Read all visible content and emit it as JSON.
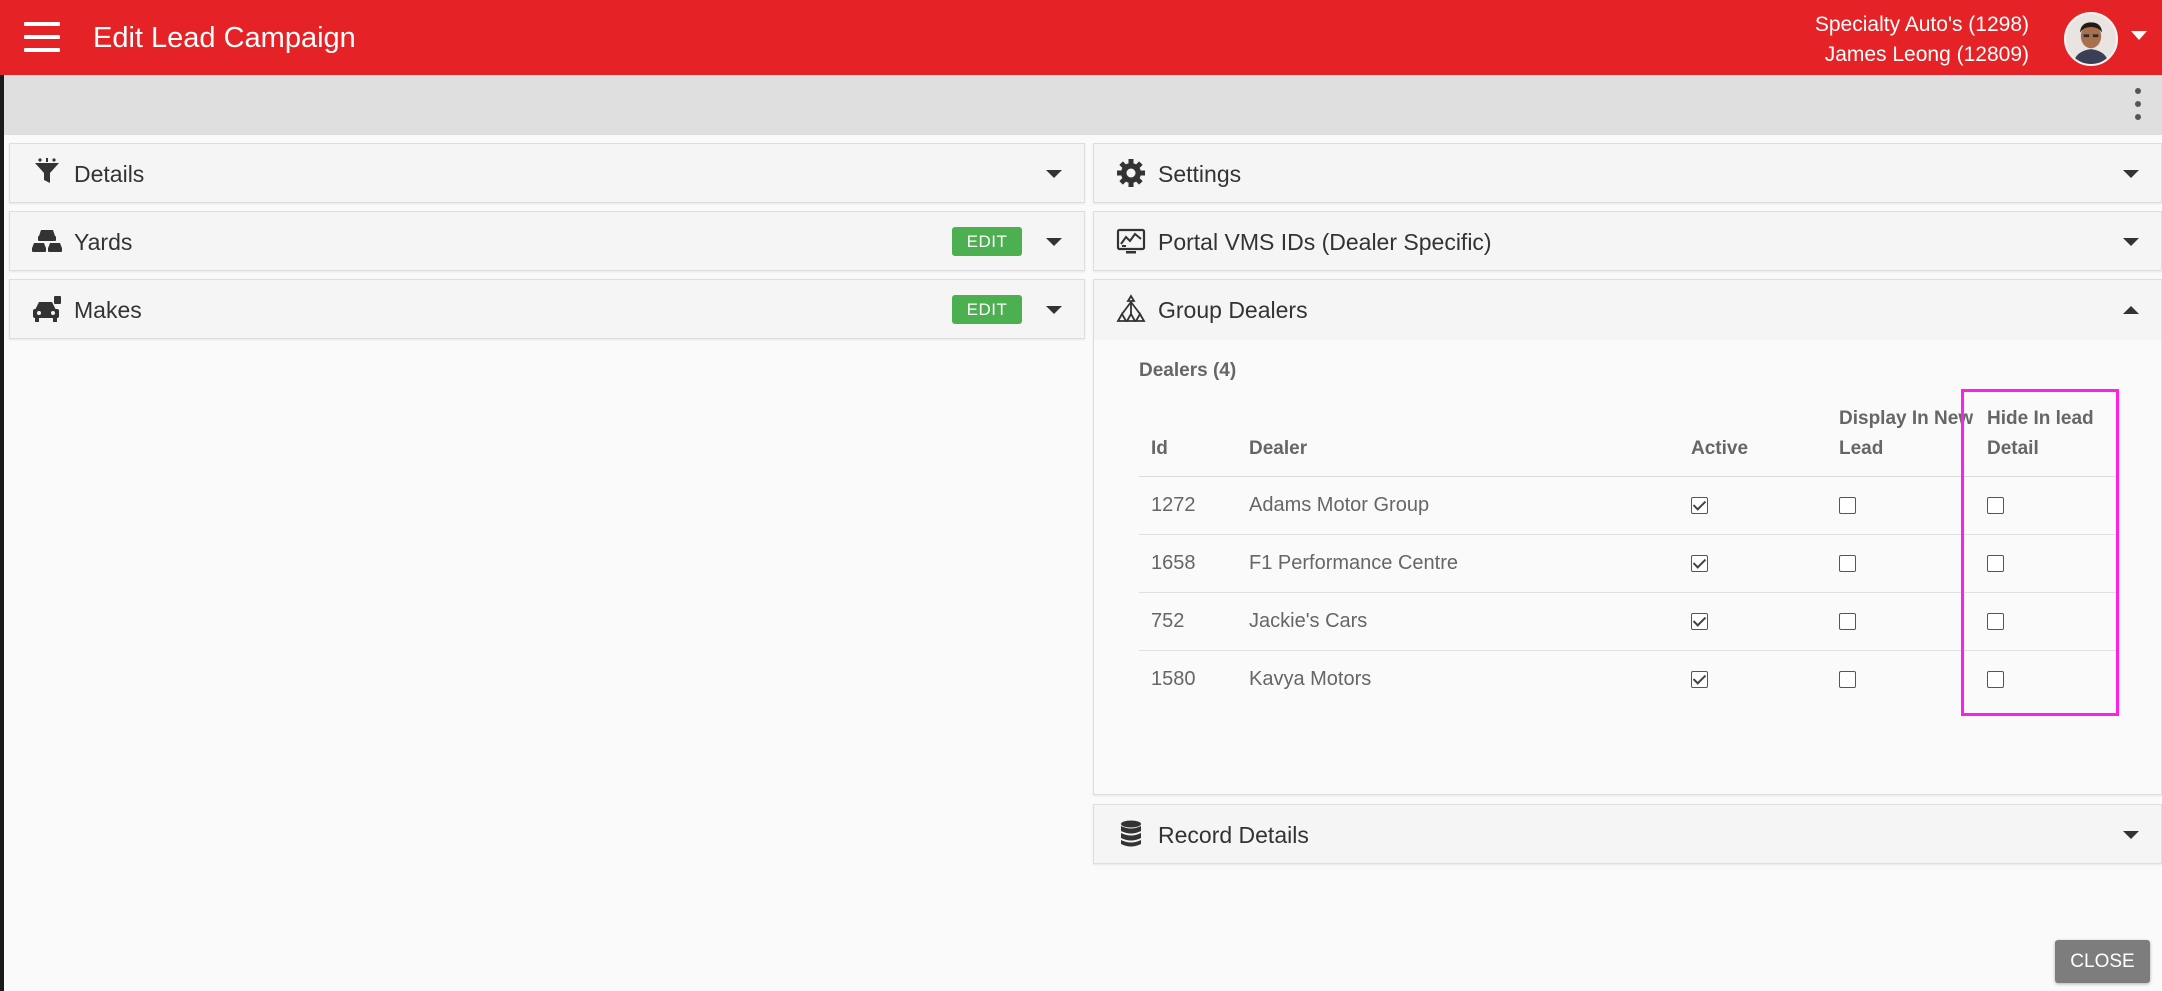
{
  "header": {
    "title": "Edit Lead Campaign",
    "company": "Specialty Auto's (1298)",
    "user": "James Leong (12809)",
    "accent_color": "#e52225"
  },
  "left_panels": [
    {
      "title": "Details",
      "icon": "funnel-icon"
    },
    {
      "title": "Yards",
      "icon": "cars-yard-icon",
      "edit_label": "EDIT"
    },
    {
      "title": "Makes",
      "icon": "car-icon",
      "edit_label": "EDIT"
    }
  ],
  "right_panels": {
    "settings": {
      "title": "Settings",
      "icon": "gear-icon"
    },
    "portal": {
      "title": "Portal VMS IDs (Dealer Specific)",
      "icon": "monitor-chart-icon"
    },
    "group_dealers": {
      "title": "Group Dealers",
      "icon": "hierarchy-icon",
      "dealers_count": "Dealers (4)",
      "columns": [
        "Id",
        "Dealer",
        "Active",
        "Display In New Lead",
        "Hide In lead Detail"
      ],
      "rows": [
        {
          "id": "1272",
          "dealer": "Adams Motor Group",
          "active": true,
          "display_new": false,
          "hide_detail": false
        },
        {
          "id": "1658",
          "dealer": "F1 Performance Centre",
          "active": true,
          "display_new": false,
          "hide_detail": false
        },
        {
          "id": "752",
          "dealer": "Jackie's Cars",
          "active": true,
          "display_new": false,
          "hide_detail": false
        },
        {
          "id": "1580",
          "dealer": "Kavya Motors",
          "active": true,
          "display_new": false,
          "hide_detail": false
        }
      ]
    },
    "record_details": {
      "title": "Record Details",
      "icon": "database-icon"
    }
  },
  "footer": {
    "close_label": "CLOSE"
  }
}
